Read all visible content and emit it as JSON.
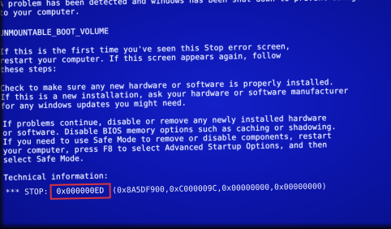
{
  "bsod": {
    "lines": [
      "A problem has been detected and windows has been shut down to prevent damage",
      "to your computer.",
      "",
      "UNMOUNTABLE_BOOT_VOLUME",
      "",
      "If this is the first time you've seen this Stop error screen,",
      "restart your computer. If this screen appears again, follow",
      "these steps:",
      "",
      "Check to make sure any new hardware or software is properly installed.",
      "If this is a new installation, ask your hardware or software manufacturer",
      "for any windows updates you might need.",
      "",
      "If problems continue, disable or remove any newly installed hardware",
      "or software. Disable BIOS memory options such as caching or shadowing.",
      "If you need to use Safe Mode to remove or disable components, restart",
      "your computer, press F8 to select Advanced Startup Options, and then",
      "select Safe Mode.",
      "",
      "Technical information:"
    ],
    "stop_prefix": "*** STOP:",
    "stop_code": "0x000000ED",
    "stop_params": "(0x8A5DF900,0xC000009C,0x00000000,0x00000000)"
  },
  "colors": {
    "background": "#0d16b0",
    "text": "#e8ecff",
    "highlight_box": "#d9343a"
  }
}
